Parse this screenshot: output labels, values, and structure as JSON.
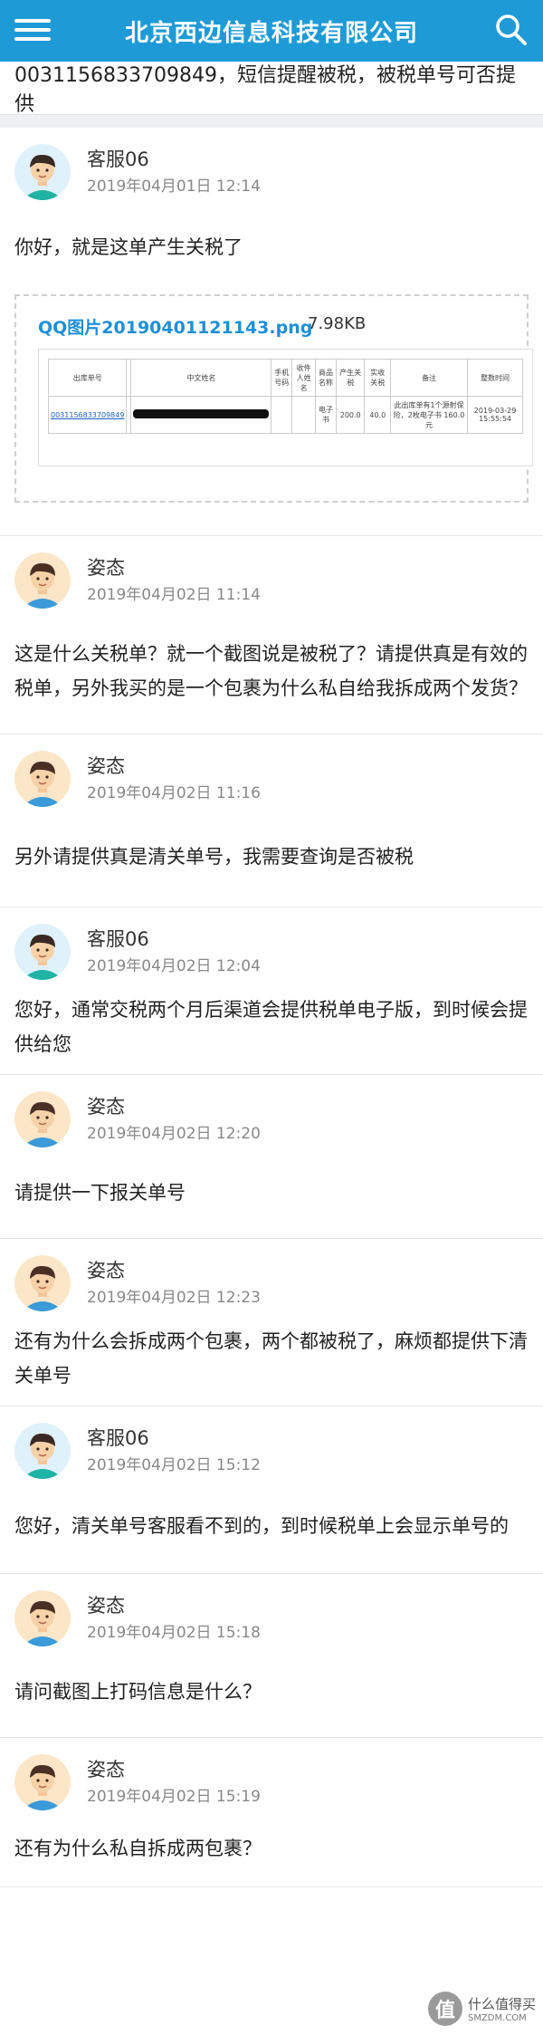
{
  "header": {
    "title": "北京西边信息科技有限公司"
  },
  "subject": "0031156833709849，短信提醒被税，被税单号可否提供",
  "messages": [
    {
      "type": "service",
      "name": "客服06",
      "time": "2019年04月01日 12:14",
      "text": "你好，就是这单产生关税了"
    },
    {
      "type": "user",
      "name": "姿态",
      "time": "2019年04月02日 11:14",
      "text": "这是什么关税单？就一个截图说是被税了？请提供真是有效的税单，另外我买的是一个包裹为什么私自给我拆成两个发货？"
    },
    {
      "type": "user",
      "name": "姿态",
      "time": "2019年04月02日 11:16",
      "text": "另外请提供真是清关单号，我需要查询是否被税"
    },
    {
      "type": "service",
      "name": "客服06",
      "time": "2019年04月02日 12:04",
      "text": "您好，通常交税两个月后渠道会提供税单电子版，到时候会提供给您"
    },
    {
      "type": "user",
      "name": "姿态",
      "time": "2019年04月02日 12:20",
      "text": "请提供一下报关单号"
    },
    {
      "type": "user",
      "name": "姿态",
      "time": "2019年04月02日 12:23",
      "text": "还有为什么会拆成两个包裹，两个都被税了，麻烦都提供下清关单号"
    },
    {
      "type": "service",
      "name": "客服06",
      "time": "2019年04月02日 15:12",
      "text": "您好，清关单号客服看不到的，到时候税单上会显示单号的"
    },
    {
      "type": "user",
      "name": "姿态",
      "time": "2019年04月02日 15:18",
      "text": "请问截图上打码信息是什么？"
    },
    {
      "type": "user",
      "name": "姿态",
      "time": "2019年04月02日 15:19",
      "text": "还有为什么私自拆成两包裹？"
    }
  ],
  "attachment": {
    "filename": "QQ图片20190401121143.png",
    "size": "7.98KB",
    "table": {
      "headers": [
        "出库单号",
        "",
        "中文姓名",
        "手机号码",
        "收件人姓名",
        "商品名称",
        "产生关税",
        "实收关税",
        "备注",
        "整数时间"
      ],
      "row": [
        "0031156833709849",
        "",
        "",
        "",
        "",
        "电子书",
        "200.0",
        "40.0",
        "此出库单有1个源射保险，2枚电子书 160.0元",
        "2019-03-29 15:55:54"
      ]
    }
  },
  "watermark": {
    "logo": "值",
    "line1": "什么值得买",
    "line2": "SMZDM.COM"
  },
  "colors": {
    "header_bg": "#1e9bd6",
    "link": "#1e90d6",
    "divider": "#e6e6e6"
  }
}
